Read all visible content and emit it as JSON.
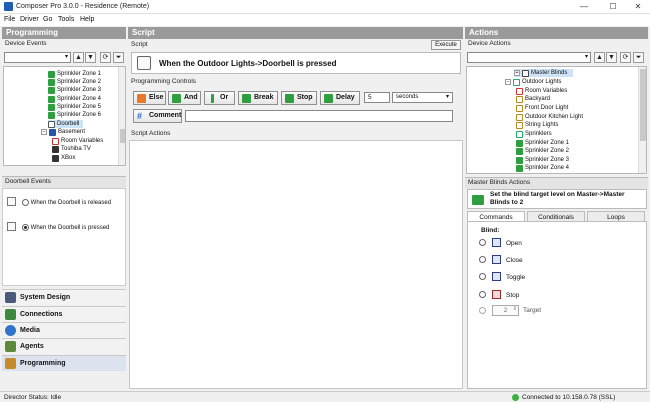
{
  "window": {
    "title": "Composer Pro 3.0.0 - Residence (Remote)"
  },
  "menu": [
    "File",
    "Driver",
    "Go",
    "Tools",
    "Help"
  ],
  "left": {
    "header": "Programming",
    "device_events_label": "Device Events",
    "tree": [
      {
        "label": "Sprinkler Zone 1",
        "icon": "green-check-icon"
      },
      {
        "label": "Sprinkler Zone 2",
        "icon": "green-check-icon"
      },
      {
        "label": "Sprinkler Zone 3",
        "icon": "green-check-icon"
      },
      {
        "label": "Sprinkler Zone 4",
        "icon": "green-check-icon"
      },
      {
        "label": "Sprinkler Zone 5",
        "icon": "green-check-icon"
      },
      {
        "label": "Sprinkler Zone 6",
        "icon": "green-check-icon"
      },
      {
        "label": "Doorbell",
        "icon": "doorbell-icon"
      },
      {
        "label": "Basement",
        "icon": "house-icon"
      },
      {
        "label": "Room Variables",
        "icon": "variables-icon"
      },
      {
        "label": "Toshiba TV",
        "icon": "tv-icon"
      },
      {
        "label": "XBox",
        "icon": "console-icon"
      }
    ],
    "events_header": "Doorbell Events",
    "events": [
      {
        "label": "When the Doorbell is released",
        "selected": false
      },
      {
        "label": "When the Doorbell is pressed",
        "selected": true
      }
    ],
    "nav": [
      "System Design",
      "Connections",
      "Media",
      "Agents",
      "Programming"
    ]
  },
  "center": {
    "header": "Script",
    "script_label": "Script",
    "execute": "Execute",
    "script_title": "When the Outdoor Lights->Doorbell is pressed",
    "controls_label": "Programming Controls",
    "buttons": [
      "Else",
      "And",
      "Or",
      "Break",
      "Stop",
      "Delay"
    ],
    "delay_value": "5",
    "delay_unit": "seconds",
    "comment": "Comment",
    "actions_label": "Script Actions"
  },
  "right": {
    "header": "Actions",
    "device_actions_label": "Device Actions",
    "tree": [
      {
        "label": "Master Blinds",
        "icon": "blinds-icon"
      },
      {
        "label": "Outdoor Lights",
        "icon": "list-icon"
      },
      {
        "label": "Room Variables",
        "icon": "variables-icon"
      },
      {
        "label": "Backyard",
        "icon": "bulb-icon"
      },
      {
        "label": "Front Door Light",
        "icon": "bulb-icon"
      },
      {
        "label": "Outdoor Kitchen Light",
        "icon": "bulb-icon"
      },
      {
        "label": "String Lights",
        "icon": "bulb-icon"
      },
      {
        "label": "Sprinklers",
        "icon": "list-icon"
      },
      {
        "label": "Sprinkler Zone 1",
        "icon": "green-check-icon"
      },
      {
        "label": "Sprinkler Zone 2",
        "icon": "green-check-icon"
      },
      {
        "label": "Sprinkler Zone 3",
        "icon": "green-check-icon"
      },
      {
        "label": "Sprinkler Zone 4",
        "icon": "green-check-icon"
      }
    ],
    "actions_header": "Master Blinds Actions",
    "action_text": "Set the blind target level on Master->Master Blinds to 2",
    "tabs": [
      "Commands",
      "Conditionals",
      "Loops"
    ],
    "blind_label": "Blind:",
    "commands": [
      "Open",
      "Close",
      "Toggle",
      "Stop"
    ],
    "target_value": "2",
    "target_label": "Target"
  },
  "status": {
    "left": "Director Status: Idle",
    "right": "Connected to 10.158.0.78 (SSL)"
  }
}
